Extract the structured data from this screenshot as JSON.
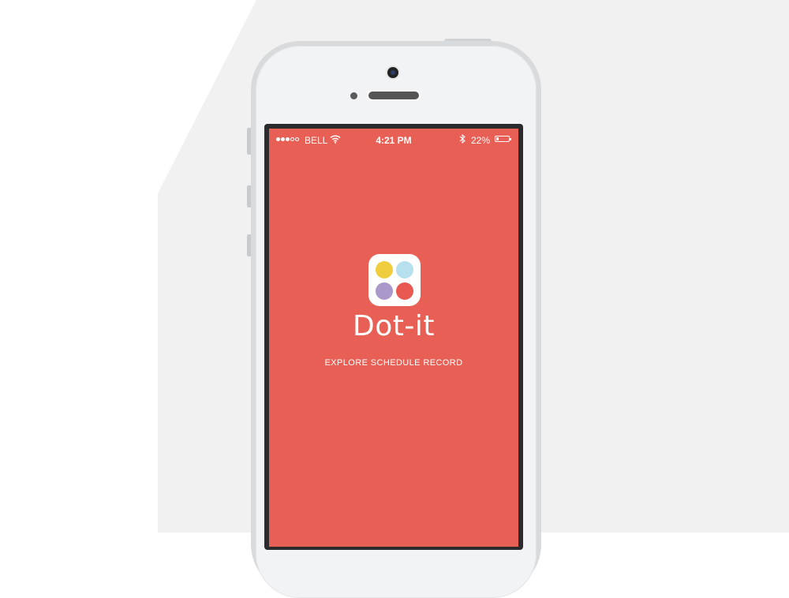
{
  "status_bar": {
    "signal_dots_filled": 3,
    "signal_dots_total": 5,
    "carrier": "BELL",
    "time": "4:21 PM",
    "battery_percent": "22%",
    "battery_level": 0.22
  },
  "app": {
    "name": "Dot-it",
    "tagline": "EXPLORE  SCHEDULE  RECORD",
    "logo_dot_colors": [
      "#efcd3e",
      "#b7e0ee",
      "#a998c9",
      "#e85a51"
    ]
  },
  "colors": {
    "screen_background": "#e86055"
  },
  "icons": [
    "wifi-icon",
    "bluetooth-icon",
    "battery-icon",
    "app-logo-icon"
  ]
}
